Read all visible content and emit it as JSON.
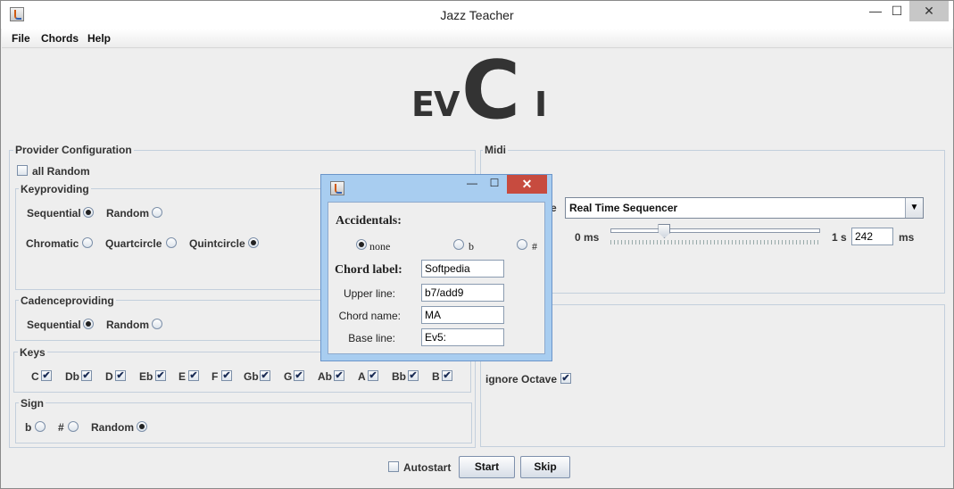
{
  "window": {
    "title": "Jazz Teacher",
    "minimize": "—",
    "maximize": "☐",
    "close": "✕"
  },
  "menu": {
    "file": "File",
    "chords": "Chords",
    "help": "Help"
  },
  "logo": {
    "ev": "EV",
    "c": "C",
    "i": "I"
  },
  "provider": {
    "title": "Provider Configuration",
    "all_random": "all Random",
    "all_random_checked": false,
    "keyproviding": {
      "title": "Keyproviding",
      "sequential": "Sequential",
      "random": "Random",
      "chromatic": "Chromatic",
      "quartcircle": "Quartcircle",
      "quintcircle": "Quintcircle",
      "selected_order": "Sequential",
      "selected_circle": "Quintcircle"
    },
    "cadenceproviding": {
      "title": "Cadenceproviding",
      "sequential": "Sequential",
      "random": "Random",
      "selected": "Sequential"
    },
    "keys": {
      "title": "Keys",
      "items": [
        "C",
        "Db",
        "D",
        "Eb",
        "E",
        "F",
        "Gb",
        "G",
        "Ab",
        "A",
        "Bb",
        "B"
      ],
      "checked": [
        true,
        true,
        true,
        true,
        true,
        true,
        true,
        true,
        true,
        true,
        true,
        true
      ]
    },
    "sign": {
      "title": "Sign",
      "flat": "b",
      "sharp": "#",
      "random": "Random",
      "selected": "Random"
    }
  },
  "midi": {
    "title": "Midi",
    "device_label_fragment": "e",
    "device": "Real Time Sequencer",
    "min_label": "0 ms",
    "max_label": "1 s",
    "latency_value": "242",
    "latency_unit": "ms",
    "slider_fraction": 0.242,
    "ignore_octave": "ignore Octave",
    "ignore_octave_checked": true
  },
  "footer": {
    "autostart": "Autostart",
    "autostart_checked": false,
    "start": "Start",
    "skip": "Skip"
  },
  "popup": {
    "minimize": "—",
    "maximize": "☐",
    "close": "✕",
    "accidentals": "Accidentals:",
    "none": "none",
    "flat": "b",
    "sharp": "#",
    "selected": "none",
    "chord_label": "Chord label:",
    "chord_label_value": "Softpedia",
    "upper_line": "Upper line:",
    "upper_line_value": "b7/add9",
    "chord_name": "Chord name:",
    "chord_name_value": "MA",
    "base_line": "Base line:",
    "base_line_value": "Ev5:"
  }
}
